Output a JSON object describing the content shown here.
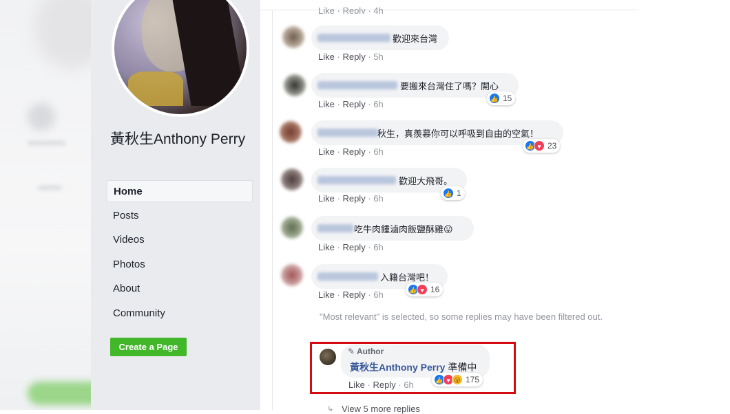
{
  "sidebar": {
    "page_name": "黃秋生Anthony Perry",
    "nav": [
      {
        "label": "Home",
        "active": true
      },
      {
        "label": "Posts"
      },
      {
        "label": "Videos"
      },
      {
        "label": "Photos"
      },
      {
        "label": "About"
      },
      {
        "label": "Community"
      }
    ],
    "create_button": "Create a Page"
  },
  "labels": {
    "like": "Like",
    "reply": "Reply",
    "sep": "·"
  },
  "top_cut_time": "4h",
  "comments": [
    {
      "text": "歡迎來台灣",
      "time": "5h"
    },
    {
      "text": "要搬來台灣住了嗎？開心",
      "time": "6h",
      "reactions": [
        "like"
      ],
      "count": "15"
    },
    {
      "text": "秋生，真羨慕你可以呼吸到自由的空氣！",
      "time": "6h",
      "reactions": [
        "like",
        "love"
      ],
      "count": "23"
    },
    {
      "text": "歡迎大飛哥。",
      "time": "6h",
      "reactions": [
        "like"
      ],
      "count": "1"
    },
    {
      "text": "吃牛肉鍾滷肉飯鹽酥雞😛",
      "time": "6h"
    },
    {
      "text": "入籍台灣吧！",
      "time": "6h",
      "reactions": [
        "like",
        "love"
      ],
      "count": "16"
    }
  ],
  "notice": "\"Most relevant\" is selected, so some replies may have been filtered out.",
  "author_reply": {
    "tag": "Author",
    "name": "黃秋生Anthony Perry",
    "text": "準備中",
    "time": "6h",
    "reactions": [
      "like",
      "love",
      "wow"
    ],
    "count": "175"
  },
  "view_more": "View 5 more replies",
  "colors": {
    "like": "#1877f2",
    "love": "#f33e58",
    "wow": "#f7b928",
    "highlight": "#d40b10",
    "create_btn": "#42b72a",
    "name_link": "#385898"
  }
}
